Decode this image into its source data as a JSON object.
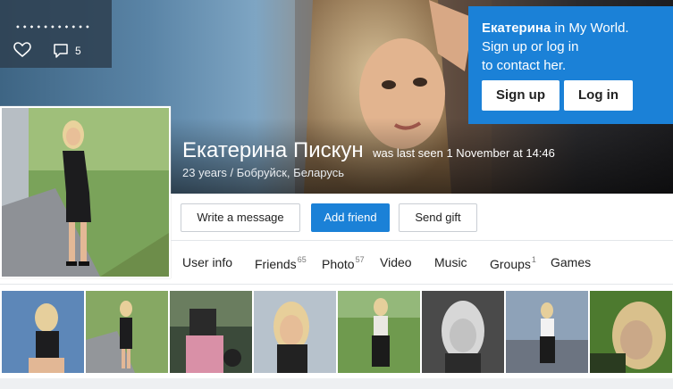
{
  "stats": {
    "likes_icon": "heart-icon",
    "comments_icon": "comment-icon",
    "comment_count": "5"
  },
  "signup": {
    "name": "Екатерина",
    "line1_rest": " in My World.",
    "line2": "Sign up or log in",
    "line3": "to contact her.",
    "signup_label": "Sign up",
    "login_label": "Log in"
  },
  "profile": {
    "name": "Екатерина Пискун",
    "last_seen": "was last seen 1 November at 14:46",
    "location": "23 years / Бобруйск, Беларусь"
  },
  "actions": {
    "message_label": "Write a message",
    "add_friend_label": "Add friend",
    "gift_label": "Send gift"
  },
  "tabs": [
    {
      "label": "User info",
      "count": ""
    },
    {
      "label": "Friends",
      "count": "65"
    },
    {
      "label": "Photo",
      "count": "57"
    },
    {
      "label": "Video",
      "count": ""
    },
    {
      "label": "Music",
      "count": ""
    },
    {
      "label": "Groups",
      "count": "1"
    },
    {
      "label": "Games",
      "count": ""
    }
  ],
  "colors": {
    "accent": "#1b81d7",
    "stats_bg": "#2f4152"
  }
}
